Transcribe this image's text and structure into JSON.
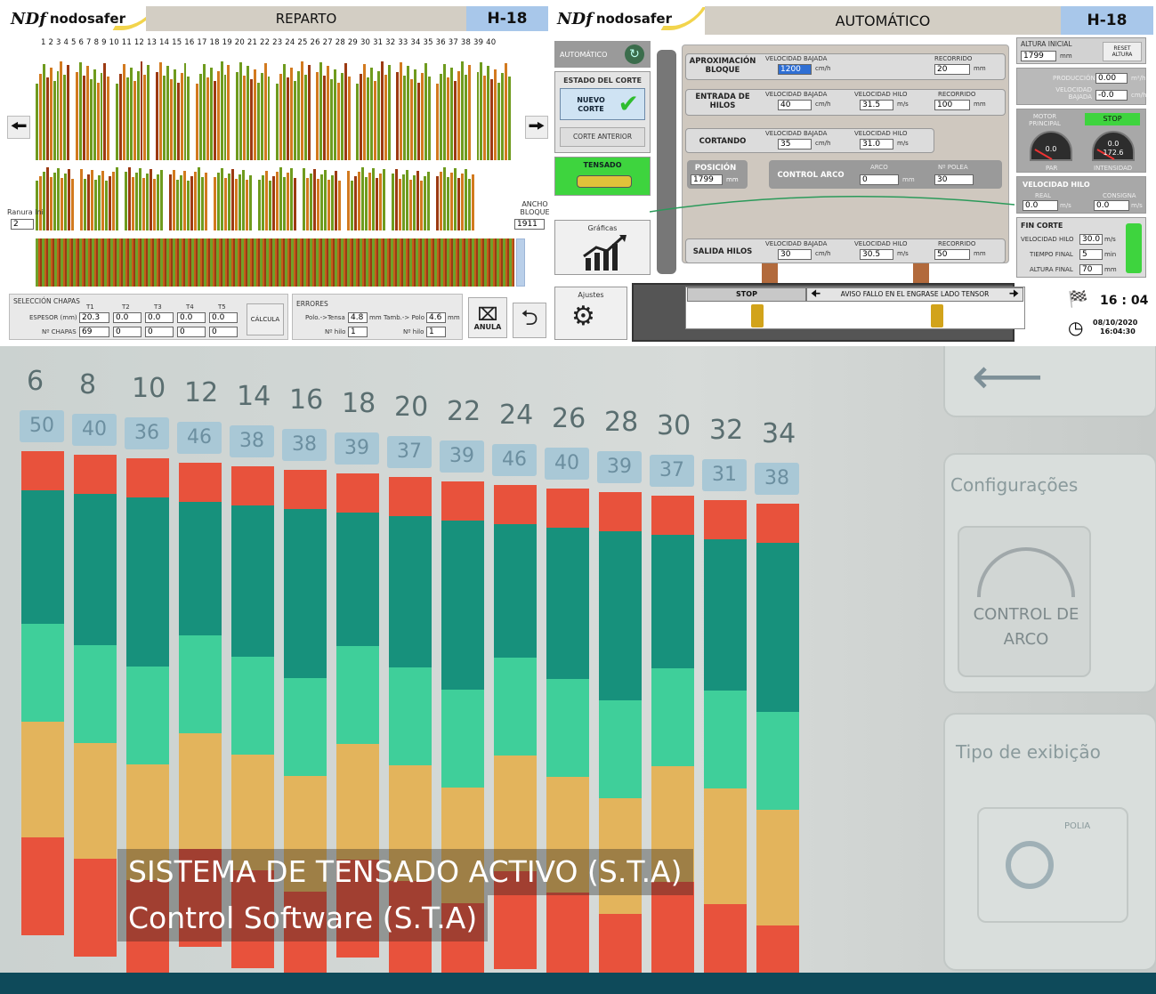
{
  "reparto": {
    "brand": "nodosafer",
    "logo_mark": "NDf",
    "title": "REPARTO",
    "id": "H-18",
    "slot_numbers": "1 2 3 4 5 6 7 8 9 10 11 12 13 14 15 16 17 18 19 20 21 22 23 24 25 26 27 28 29 30 31 32 33 34 35 36 37 38 39 40",
    "ranura_label": "Ranura Ini",
    "ranura_value": "2",
    "ancho_label": "ANCHO BLOQUE",
    "ancho_value": "1911",
    "seleccion": {
      "title": "SELECCIÓN CHAPAS",
      "cols": [
        "T1",
        "T2",
        "T3",
        "T4",
        "T5"
      ],
      "espesor_label": "ESPESOR (mm)",
      "espesor_values": [
        "20.3",
        "0.0",
        "0.0",
        "0.0",
        "0.0"
      ],
      "chapas_label": "Nº CHAPAS",
      "chapas_values": [
        "69",
        "0",
        "0",
        "0",
        "0"
      ],
      "calcula": "CÁLCULA"
    },
    "errores": {
      "title": "ERRORES",
      "polo_tensa_label": "Polo.->Tensa",
      "polo_tensa_value": "4.8",
      "unit1": "mm",
      "tamb_polo_label": "Tamb.-> Polo",
      "tamb_polo_value": "4.6",
      "unit2": "mm",
      "hilo_label_1": "Nº hilo",
      "hilo_value_1": "1",
      "hilo_label_2": "Nº hilo",
      "hilo_value_2": "1"
    },
    "anula_label": "ANULA"
  },
  "automatico": {
    "brand": "nodosafer",
    "logo_mark": "NDf",
    "title": "AUTOMÁTICO",
    "id": "H-18",
    "mode_button": "AUTOMÁTICO",
    "estado_title": "ESTADO DEL CORTE",
    "nuevo_corte": "NUEVO CORTE",
    "corte_anterior": "CORTE ANTERIOR",
    "tensado": "TENSADO",
    "graficas": "Gráficas",
    "ajustes": "Ajustes",
    "aproximacion": {
      "label": "APROXIMACIÓN BLOQUE",
      "vel_label": "VELOCIDAD BAJADA",
      "vel_value": "1200",
      "vel_unit": "cm/h",
      "rec_label": "RECORRIDO",
      "rec_value": "20",
      "rec_unit": "mm"
    },
    "entrada": {
      "label": "ENTRADA DE HILOS",
      "vel_label": "VELOCIDAD BAJADA",
      "vel_value": "40",
      "vel_unit": "cm/h",
      "hilo_label": "VELOCIDAD HILO",
      "hilo_value": "31.5",
      "hilo_unit": "m/s",
      "rec_label": "RECORRIDO",
      "rec_value": "100",
      "rec_unit": "mm"
    },
    "cortando": {
      "label": "CORTANDO",
      "vel_label": "VELOCIDAD BAJADA",
      "vel_value": "35",
      "vel_unit": "cm/h",
      "hilo_label": "VELOCIDAD HILO",
      "hilo_value": "31.0",
      "hilo_unit": "m/s"
    },
    "posicion": {
      "label": "POSICIÓN",
      "value": "1799",
      "unit": "mm"
    },
    "control_arco": {
      "label": "CONTROL ARCO",
      "arco_label": "ARCO",
      "arco_value": "0",
      "arco_unit": "mm",
      "polea_label": "Nº POLEA",
      "polea_value": "30"
    },
    "salida": {
      "label": "SALIDA HILOS",
      "vel_label": "VELOCIDAD BAJADA",
      "vel_value": "30",
      "vel_unit": "cm/h",
      "hilo_label": "VELOCIDAD HILO",
      "hilo_value": "30.5",
      "hilo_unit": "m/s",
      "rec_label": "RECORRIDO",
      "rec_value": "50",
      "rec_unit": "mm"
    },
    "status_stop": "STOP",
    "status_message": "AVISO FALLO EN EL ENGRASE LADO TENSOR",
    "altura_inicial": {
      "label": "ALTURA INICIAL",
      "value": "1799",
      "unit": "mm",
      "reset": "RESET ALTURA"
    },
    "produccion": {
      "label": "PRODUCCIÓN",
      "value": "0.00",
      "unit": "m²/h"
    },
    "velocidad_bajada": {
      "label": "VELOCIDAD BAJADA",
      "value": "-0.0",
      "unit": "cm/h"
    },
    "motor": {
      "label": "MOTOR PRINCIPAL",
      "state": "STOP",
      "par_value": "0.0",
      "par_label": "PAR",
      "int_value": "0.0",
      "int_sub": "172.6",
      "int_label": "INTENSIDAD"
    },
    "velocidad_hilo": {
      "label": "VELOCIDAD HILO",
      "real_label": "REAL",
      "real_value": "0.0",
      "real_unit": "m/s",
      "consigna_label": "CONSIGNA",
      "consigna_value": "0.0",
      "consigna_unit": "m/s"
    },
    "fin_corte": {
      "label": "FIN CORTE",
      "vel_label": "VELOCIDAD HILO",
      "vel_value": "30.0",
      "vel_unit": "m/s",
      "tiempo_label": "TIEMPO FINAL",
      "tiempo_value": "5",
      "tiempo_unit": "min",
      "altura_label": "ALTURA FINAL",
      "altura_value": "70",
      "altura_unit": "mm"
    },
    "eta": "16 : 04",
    "date": "08/10/2020",
    "time": "16:04:30"
  },
  "photo": {
    "column_numbers": [
      "6",
      "8",
      "10",
      "12",
      "14",
      "16",
      "18",
      "20",
      "22",
      "24",
      "26",
      "28",
      "30",
      "32",
      "34"
    ],
    "column_values": [
      "50",
      "40",
      "36",
      "46",
      "38",
      "38",
      "39",
      "37",
      "39",
      "46",
      "40",
      "39",
      "37",
      "31",
      "38"
    ],
    "configuracoes": "Configurações",
    "control_de_arco": "CONTROL DE ARCO",
    "tipo_exibicao": "Tipo de exibição",
    "polia": "POLIA",
    "caption_line1": "SISTEMA DE TENSADO ACTIVO (S.T.A)",
    "caption_line2": "Control Software (S.T.A)"
  },
  "colors": {
    "header_gray": "#d3cec4",
    "header_blue": "#a8c7ea",
    "logo_yellow": "#f2d44c",
    "bar_green": "#6f9b1e",
    "bar_orange": "#d27a1f",
    "meter_red": "#e8523c",
    "meter_teal": "#17917c",
    "meter_mint": "#3fcf9a",
    "meter_amber": "#e3b45c",
    "fin_corte_green": "#3ed43e"
  }
}
